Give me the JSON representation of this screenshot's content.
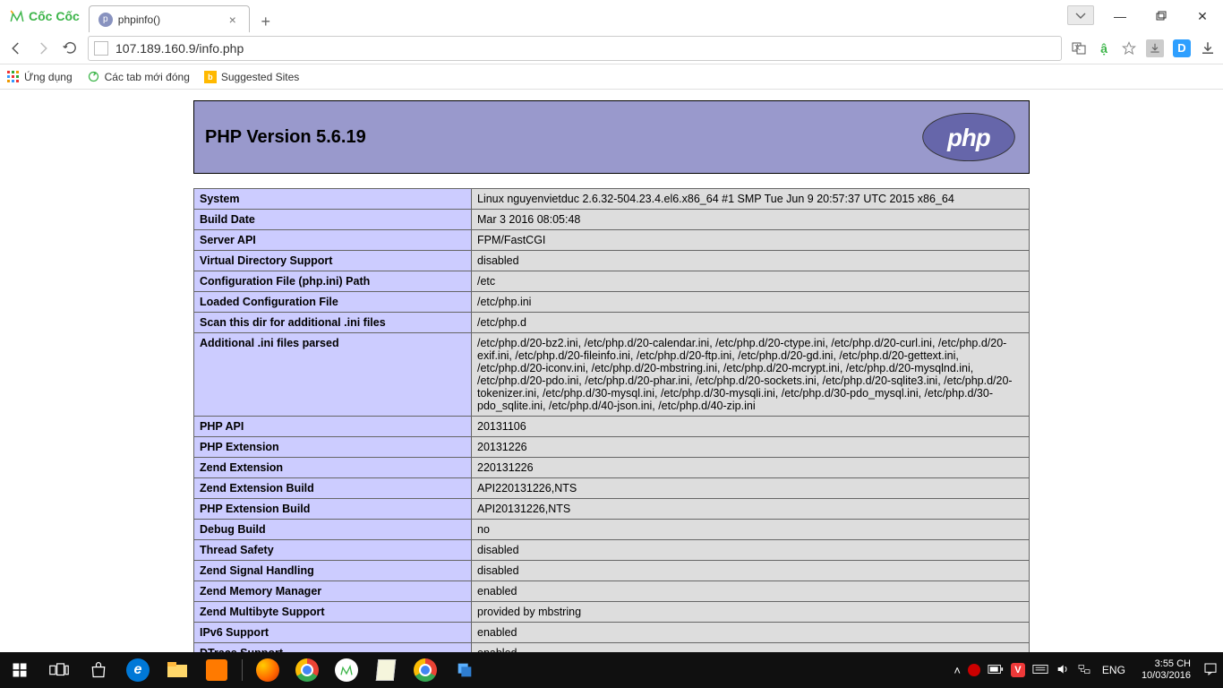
{
  "window": {
    "min": "—",
    "max": "▭",
    "close": "✕",
    "tabtray": "▾"
  },
  "browser": {
    "logoText": "Cốc Cốc",
    "tab": {
      "title": "phpinfo()",
      "close": "×"
    },
    "newtab": "+",
    "nav": {
      "back": "←",
      "forward": "→",
      "reload": "⟳"
    },
    "address": "107.189.160.9/info.php",
    "right_icons": [
      "translate-icon",
      "adblock-icon",
      "star-icon",
      "download-icon-small",
      "d-icon",
      "download-icon"
    ],
    "bookmarks": {
      "apps": "Ứng dụng",
      "recently": "Các tab mới đóng",
      "suggested": "Suggested Sites"
    }
  },
  "phpinfo": {
    "title": "PHP Version 5.6.19",
    "logoText": "php",
    "rows": [
      {
        "k": "System",
        "v": "Linux nguyenvietduc 2.6.32-504.23.4.el6.x86_64 #1 SMP Tue Jun 9 20:57:37 UTC 2015 x86_64"
      },
      {
        "k": "Build Date",
        "v": "Mar 3 2016 08:05:48"
      },
      {
        "k": "Server API",
        "v": "FPM/FastCGI"
      },
      {
        "k": "Virtual Directory Support",
        "v": "disabled"
      },
      {
        "k": "Configuration File (php.ini) Path",
        "v": "/etc"
      },
      {
        "k": "Loaded Configuration File",
        "v": "/etc/php.ini"
      },
      {
        "k": "Scan this dir for additional .ini files",
        "v": "/etc/php.d"
      },
      {
        "k": "Additional .ini files parsed",
        "v": "/etc/php.d/20-bz2.ini, /etc/php.d/20-calendar.ini, /etc/php.d/20-ctype.ini, /etc/php.d/20-curl.ini, /etc/php.d/20-exif.ini, /etc/php.d/20-fileinfo.ini, /etc/php.d/20-ftp.ini, /etc/php.d/20-gd.ini, /etc/php.d/20-gettext.ini, /etc/php.d/20-iconv.ini, /etc/php.d/20-mbstring.ini, /etc/php.d/20-mcrypt.ini, /etc/php.d/20-mysqlnd.ini, /etc/php.d/20-pdo.ini, /etc/php.d/20-phar.ini, /etc/php.d/20-sockets.ini, /etc/php.d/20-sqlite3.ini, /etc/php.d/20-tokenizer.ini, /etc/php.d/30-mysql.ini, /etc/php.d/30-mysqli.ini, /etc/php.d/30-pdo_mysql.ini, /etc/php.d/30-pdo_sqlite.ini, /etc/php.d/40-json.ini, /etc/php.d/40-zip.ini"
      },
      {
        "k": "PHP API",
        "v": "20131106"
      },
      {
        "k": "PHP Extension",
        "v": "20131226"
      },
      {
        "k": "Zend Extension",
        "v": "220131226"
      },
      {
        "k": "Zend Extension Build",
        "v": "API220131226,NTS"
      },
      {
        "k": "PHP Extension Build",
        "v": "API20131226,NTS"
      },
      {
        "k": "Debug Build",
        "v": "no"
      },
      {
        "k": "Thread Safety",
        "v": "disabled"
      },
      {
        "k": "Zend Signal Handling",
        "v": "disabled"
      },
      {
        "k": "Zend Memory Manager",
        "v": "enabled"
      },
      {
        "k": "Zend Multibyte Support",
        "v": "provided by mbstring"
      },
      {
        "k": "IPv6 Support",
        "v": "enabled"
      },
      {
        "k": "DTrace Support",
        "v": "enabled"
      }
    ]
  },
  "taskbar": {
    "lang": "ENG",
    "time": "3:55 CH",
    "date": "10/03/2016"
  }
}
